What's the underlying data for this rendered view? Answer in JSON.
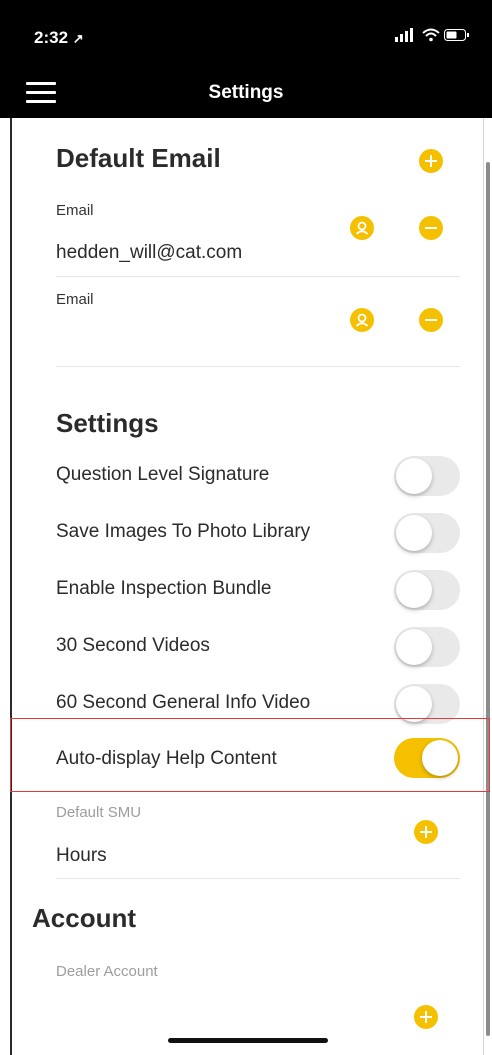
{
  "status_bar": {
    "time": "2:32",
    "location_arrow": "↗",
    "icons": "signal wifi battery"
  },
  "nav": {
    "title": "Settings",
    "menu_icon": "hamburger-menu-icon"
  },
  "default_email": {
    "title": "Default Email",
    "entries": [
      {
        "label": "Email",
        "value": "hedden_will@cat.com"
      },
      {
        "label": "Email",
        "value": ""
      }
    ]
  },
  "settings": {
    "title": "Settings",
    "toggles": [
      {
        "label": "Question Level Signature",
        "on": false
      },
      {
        "label": "Save Images To Photo Library",
        "on": false
      },
      {
        "label": "Enable Inspection Bundle",
        "on": false
      },
      {
        "label": "30 Second Videos",
        "on": false
      },
      {
        "label": "60 Second General Info Video",
        "on": false
      },
      {
        "label": "Auto-display Help Content",
        "on": true
      }
    ],
    "default_smu": {
      "label": "Default SMU",
      "value": "Hours"
    }
  },
  "account": {
    "title": "Account",
    "dealer_account": {
      "label": "Dealer Account",
      "value": ""
    }
  },
  "colors": {
    "accent": "#f4c000",
    "highlight_border": "#e53a3a",
    "navbar": "#000000"
  }
}
